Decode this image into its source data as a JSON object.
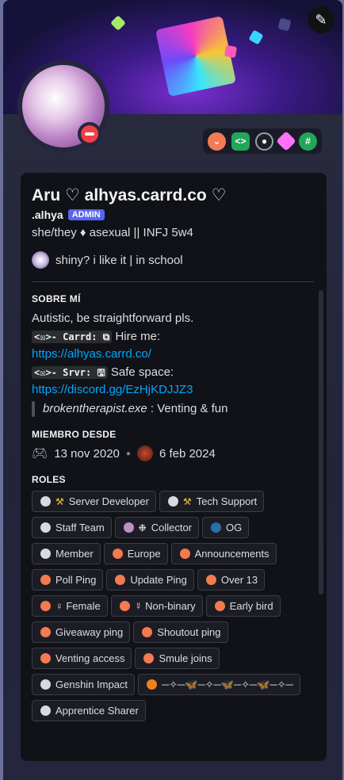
{
  "profile": {
    "display_name": "Aru ♡ alhyas.carrd.co ♡",
    "username": ".alhya",
    "admin_badge": "ADMIN",
    "pronouns": "she/they ♦ asexual || INFJ 5w4",
    "custom_status": "shiny? i like it | in school"
  },
  "icons": {
    "edit": "pencil-icon",
    "status": "do-not-disturb-icon",
    "badges": [
      "hypesquad-icon",
      "active-developer-icon",
      "quest-icon",
      "nitro-icon",
      "hash-icon"
    ]
  },
  "about": {
    "title": "SOBRE MÍ",
    "line1": "Autistic, be straightforward pls.",
    "carrd_code": "<☒>- Carrd: ⧉",
    "carrd_text": "Hire me:",
    "carrd_link": "https://alhyas.carrd.co/",
    "srvr_code": "<☒>- Srvr: 🖫",
    "srvr_text": "Safe space:",
    "srvr_link": "https://discord.gg/EzHjKDJJZ3",
    "quote_italic": "brokentherapist.exe",
    "quote_rest": " : Venting & fun"
  },
  "member": {
    "title": "MIEMBRO DESDE",
    "discord_date": "13 nov 2020",
    "server_date": "6 feb 2024"
  },
  "roles": {
    "title": "ROLES",
    "items": [
      {
        "label": "Server Developer",
        "color": "#d9dadc",
        "icon": "⚒"
      },
      {
        "label": "Tech Support",
        "color": "#d9dadc",
        "icon": "⚒"
      },
      {
        "label": "Staff Team",
        "color": "#d9dadc",
        "icon": ""
      },
      {
        "label": "Collector",
        "color": "#c08fc4",
        "icon": "❉"
      },
      {
        "label": "OG",
        "color": "#2a6fa8",
        "icon": ""
      },
      {
        "label": "Member",
        "color": "#d9dadc",
        "icon": ""
      },
      {
        "label": "Europe",
        "color": "#f47a52",
        "icon": ""
      },
      {
        "label": "Announcements",
        "color": "#f47a52",
        "icon": ""
      },
      {
        "label": "Poll Ping",
        "color": "#f47a52",
        "icon": ""
      },
      {
        "label": "Update Ping",
        "color": "#f47a52",
        "icon": ""
      },
      {
        "label": "Over 13",
        "color": "#f47a52",
        "icon": ""
      },
      {
        "label": "♀ Female",
        "color": "#f47a52",
        "icon": ""
      },
      {
        "label": "☿ Non-binary",
        "color": "#f47a52",
        "icon": ""
      },
      {
        "label": "Early bird",
        "color": "#f47a52",
        "icon": ""
      },
      {
        "label": "Giveaway ping",
        "color": "#f47a52",
        "icon": ""
      },
      {
        "label": "Shoutout ping",
        "color": "#f47a52",
        "icon": ""
      },
      {
        "label": "Venting access",
        "color": "#f47a52",
        "icon": ""
      },
      {
        "label": "Smule joins",
        "color": "#f47a52",
        "icon": ""
      },
      {
        "label": "Genshin Impact",
        "color": "#d9dadc",
        "icon": ""
      },
      {
        "label": "─✧─🦋─✧─🦋─✧─🦋─✧─",
        "color": "#f0801e",
        "icon": ""
      },
      {
        "label": "Apprentice Sharer",
        "color": "#d9dadc",
        "icon": ""
      }
    ]
  }
}
